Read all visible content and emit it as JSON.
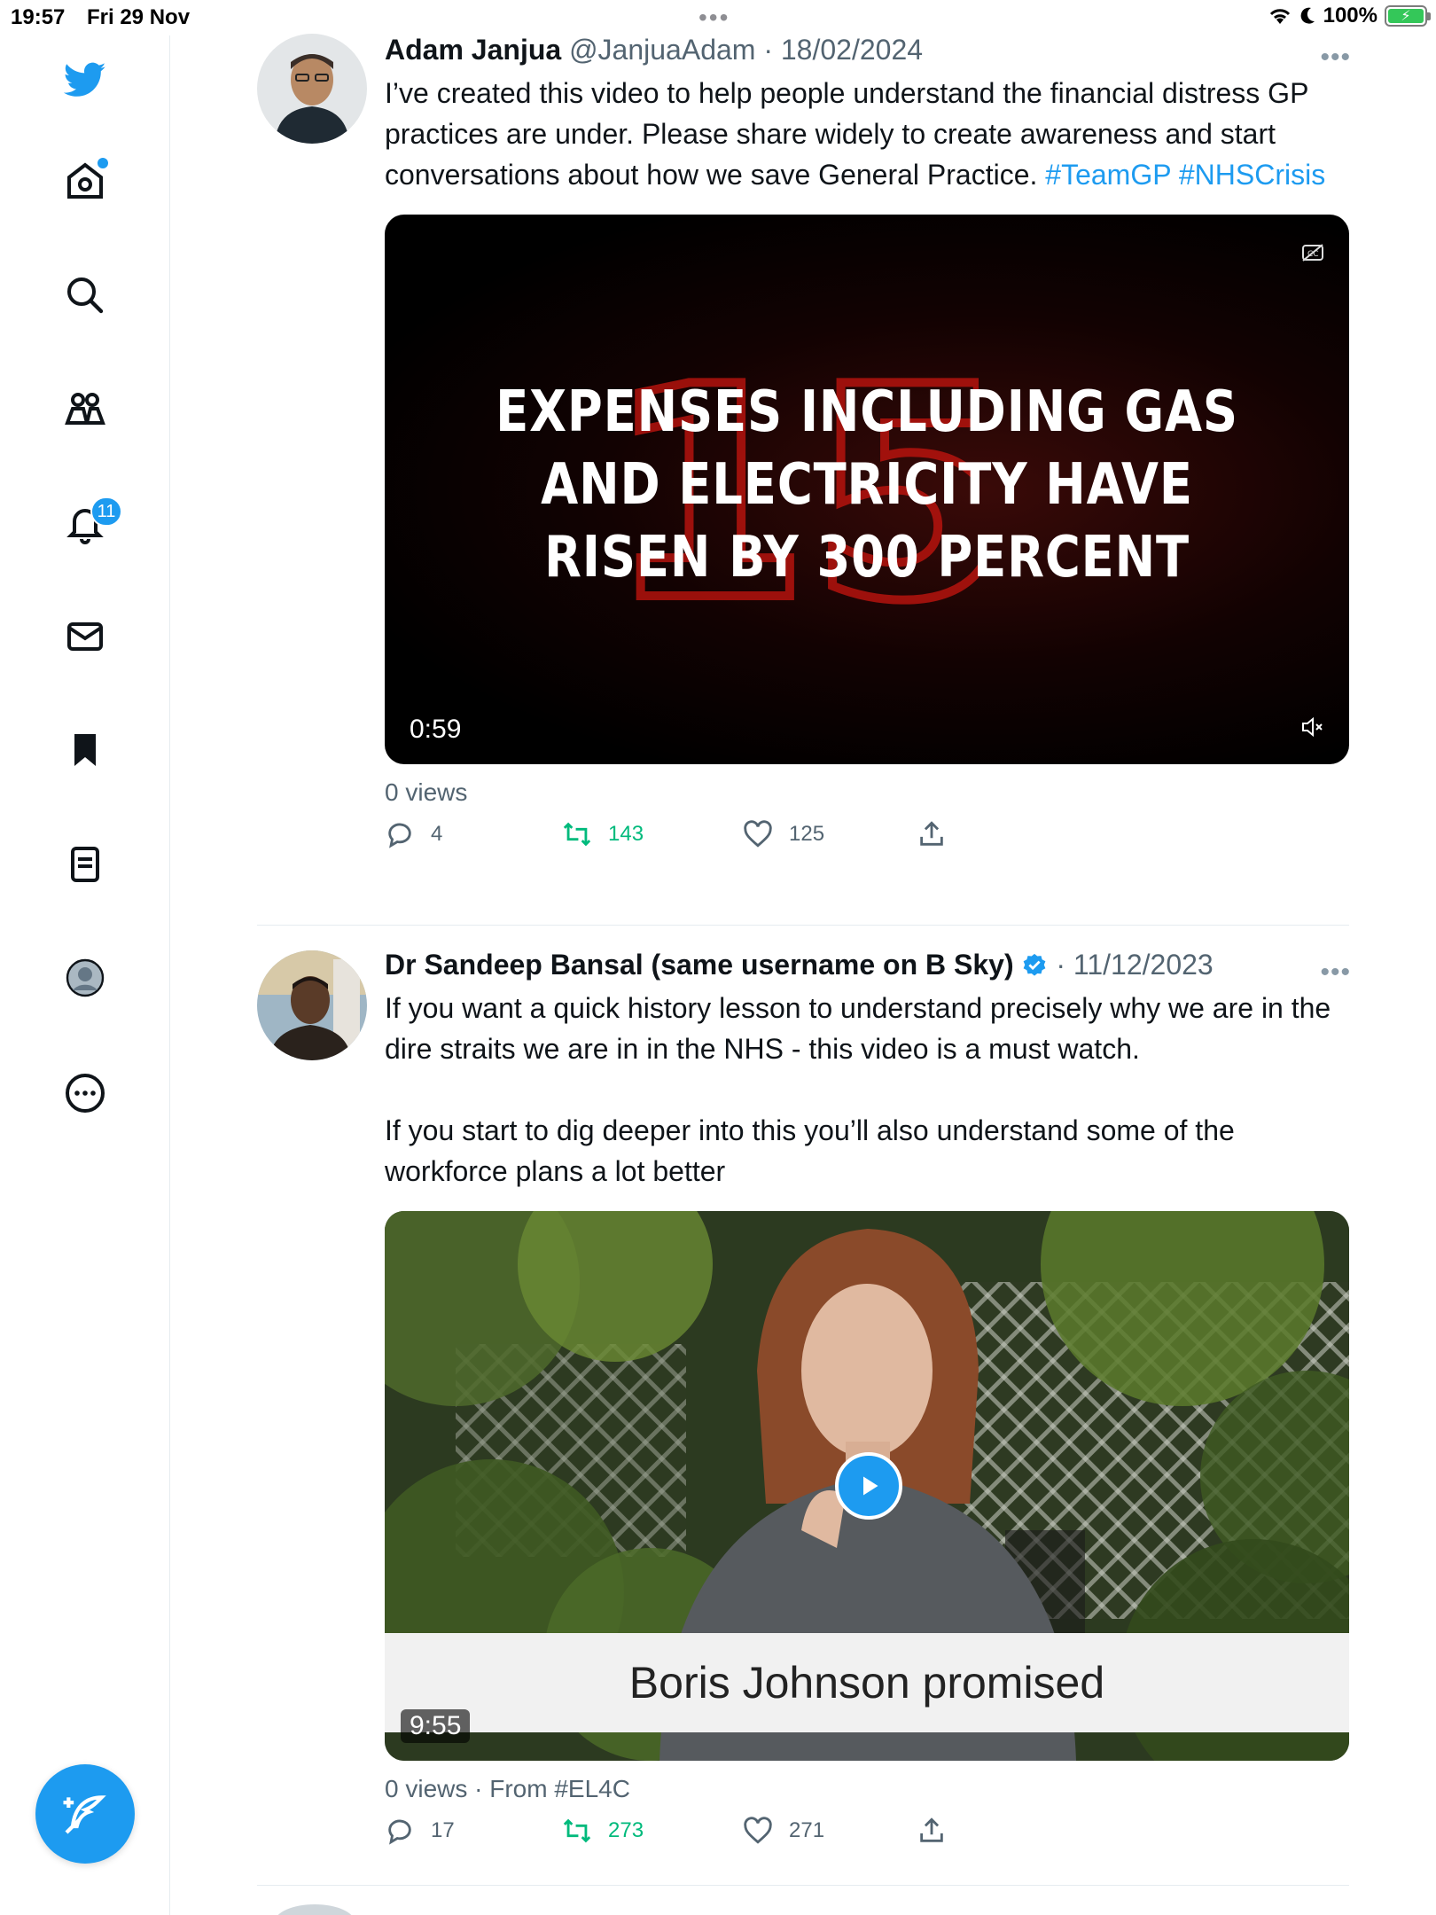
{
  "status": {
    "time": "19:57",
    "date": "Fri 29 Nov",
    "battery": "100%"
  },
  "sidebar": {
    "notifications_badge": "11"
  },
  "tweets": [
    {
      "name": "Adam Janjua",
      "handle": "@JanjuaAdam",
      "date": "18/02/2024",
      "text": "I’ve created this video to help people understand the financial distress GP practices are under. Please share widely to create awareness and start conversations about how we save General Practice.",
      "tags": [
        "#TeamGP",
        "#NHSCrisis"
      ],
      "video_text_lines": [
        "EXPENSES INCLUDING GAS",
        "AND ELECTRICITY HAVE",
        "RISEN BY 300 PERCENT"
      ],
      "duration": "0:59",
      "views": "0 views",
      "replies": "4",
      "retweets": "143",
      "likes": "125"
    },
    {
      "name": "Dr Sandeep Bansal (same username on B Sky)",
      "date": "11/12/2023",
      "text_p1": "If you want a quick history lesson to understand precisely why we are in the dire straits we are in in the NHS - this video is a must watch.",
      "text_p2": "If you start to dig deeper into this you’ll also understand some of the workforce plans a lot better",
      "caption": "Boris Johnson promised",
      "duration": "9:55",
      "views": "0 views · From #EL4C",
      "replies": "17",
      "retweets": "273",
      "likes": "271"
    }
  ],
  "colors": {
    "accent": "#1d9bf0",
    "retweet": "#00ba7c",
    "muted": "#536471"
  }
}
